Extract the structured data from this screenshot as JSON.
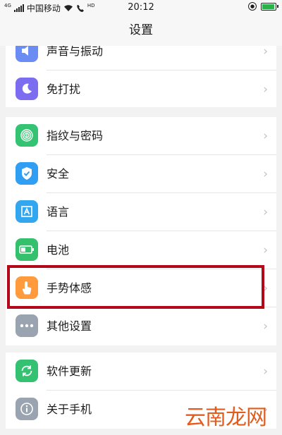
{
  "status_bar": {
    "network_tag": "4G",
    "carrier": "中国移动",
    "hd_tag": "HD",
    "time": "20:12",
    "battery_color": "#2ab14a"
  },
  "nav": {
    "title": "设置"
  },
  "groups": [
    {
      "items": [
        {
          "label": "声音与振动",
          "icon": "speaker-icon",
          "icon_color": "#6b8cf2"
        },
        {
          "label": "免打扰",
          "icon": "moon-icon",
          "icon_color": "#7b6cf0"
        }
      ]
    },
    {
      "items": [
        {
          "label": "指纹与密码",
          "icon": "fingerprint-icon",
          "icon_color": "#34c372"
        },
        {
          "label": "安全",
          "icon": "shield-icon",
          "icon_color": "#2f9ef3"
        },
        {
          "label": "语言",
          "icon": "language-icon",
          "icon_color": "#32a7f0"
        },
        {
          "label": "电池",
          "icon": "battery-icon",
          "icon_color": "#34c06c"
        },
        {
          "label": "手势体感",
          "icon": "gesture-icon",
          "icon_color": "#ff9a3d"
        },
        {
          "label": "其他设置",
          "icon": "more-icon",
          "icon_color": "#9aa3b0"
        }
      ]
    },
    {
      "items": [
        {
          "label": "软件更新",
          "icon": "update-icon",
          "icon_color": "#35c172"
        },
        {
          "label": "关于手机",
          "icon": "info-icon",
          "icon_color": "#9aa3b0"
        }
      ]
    }
  ],
  "highlight_color": "#b3081a",
  "watermark": "云南龙网"
}
